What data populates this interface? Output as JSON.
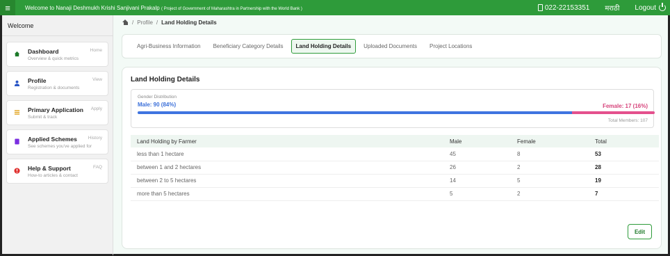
{
  "topbar": {
    "welcome_text": "Welcome to Nanaji Deshmukh Krishi Sanjivani Prakalp",
    "welcome_sub": "( Project of Government of Maharashtra in Partnership with the World Bank )",
    "phone": "022-22153351",
    "language": "मराठी",
    "logout": "Logout",
    "color": "#2e9b3a"
  },
  "sidebar": {
    "welcome": "Welcome",
    "items": [
      {
        "title": "Dashboard",
        "sub": "Overview & quick metrics",
        "tag": "Home",
        "icon": "home-icon",
        "color": "#1d7a2a"
      },
      {
        "title": "Profile",
        "sub": "Registration & documents",
        "tag": "View",
        "icon": "user-icon",
        "color": "#2a56c6"
      },
      {
        "title": "Primary Application",
        "sub": "Submit & track",
        "tag": "Apply",
        "icon": "list-icon",
        "color": "#e0a015"
      },
      {
        "title": "Applied Schemes",
        "sub": "See schemes you've applied for",
        "tag": "History",
        "icon": "folder-icon",
        "color": "#7a2ee0"
      },
      {
        "title": "Help & Support",
        "sub": "How-to articles & contact",
        "tag": "FAQ",
        "icon": "help-icon",
        "color": "#e0302e"
      }
    ]
  },
  "breadcrumb": {
    "items": [
      "Profile",
      "Land Holding Details"
    ]
  },
  "tabs": [
    {
      "label": "Agri-Business Information",
      "active": false
    },
    {
      "label": "Beneficiary Category Details",
      "active": false
    },
    {
      "label": "Land Holding Details",
      "active": true
    },
    {
      "label": "Uploaded Documents",
      "active": false
    },
    {
      "label": "Project Locations",
      "active": false
    }
  ],
  "land_holding": {
    "title": "Land Holding Details",
    "gender": {
      "label": "Gender Distribution",
      "male_text": "Male: 90 (84%)",
      "female_text": "Female: 17 (16%)",
      "total_text": "Total Members: 107",
      "male_fraction": 0.84,
      "male_color": "#3f74e0",
      "female_color": "#e4508d"
    },
    "table": {
      "headers": [
        "Land Holding by Farmer",
        "Male",
        "Female",
        "Total"
      ],
      "rows": [
        [
          "less than 1 hectare",
          "45",
          "8",
          "53"
        ],
        [
          "between 1 and 2 hectares",
          "26",
          "2",
          "28"
        ],
        [
          "between 2 to 5 hectares",
          "14",
          "5",
          "19"
        ],
        [
          "more than 5 hectares",
          "5",
          "2",
          "7"
        ]
      ]
    },
    "edit_label": "Edit"
  }
}
